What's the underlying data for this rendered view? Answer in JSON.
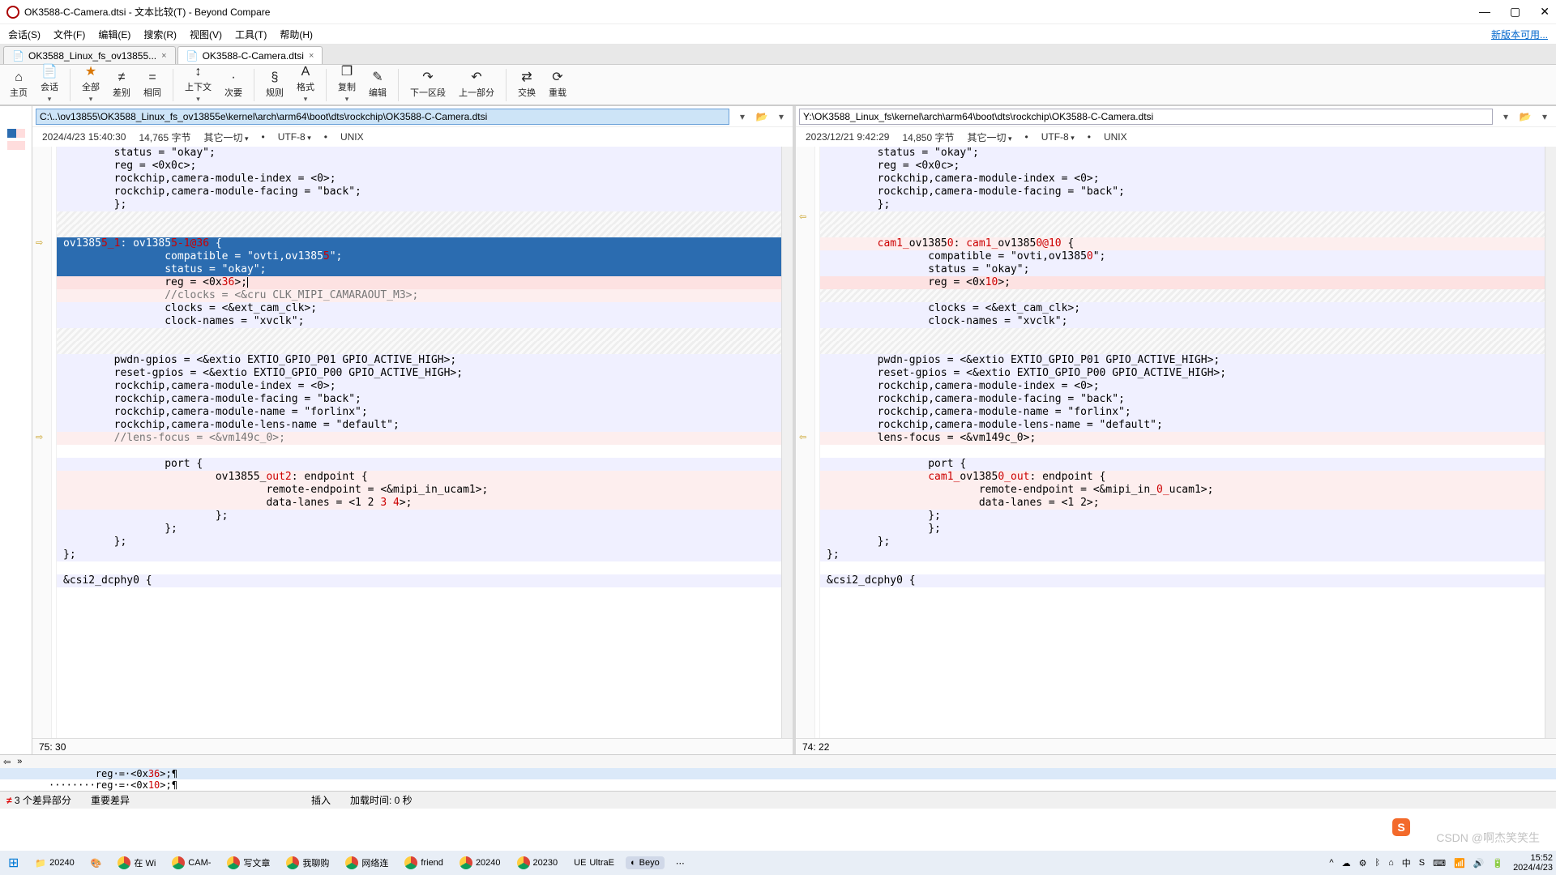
{
  "window": {
    "title": "OK3588-C-Camera.dtsi - 文本比较(T) - Beyond Compare",
    "new_version": "新版本可用..."
  },
  "menu": [
    "会话(S)",
    "文件(F)",
    "编辑(E)",
    "搜索(R)",
    "视图(V)",
    "工具(T)",
    "帮助(H)"
  ],
  "tabs": [
    {
      "label": "OK3588_Linux_fs_ov13855...",
      "active": false
    },
    {
      "label": "OK3588-C-Camera.dtsi",
      "active": true
    }
  ],
  "toolbar": [
    {
      "label": "主页",
      "glyph": "⌂"
    },
    {
      "label": "会话",
      "glyph": "📄",
      "drop": true
    },
    {
      "label": "全部",
      "glyph": "★",
      "drop": true,
      "hl": true
    },
    {
      "label": "差别",
      "glyph": "≠"
    },
    {
      "label": "相同",
      "glyph": "="
    },
    {
      "label": "上下文",
      "glyph": "↕",
      "drop": true
    },
    {
      "label": "次要",
      "glyph": "·"
    },
    {
      "label": "规则",
      "glyph": "§"
    },
    {
      "label": "格式",
      "glyph": "A",
      "drop": true
    },
    {
      "label": "复制",
      "glyph": "❐",
      "drop": true
    },
    {
      "label": "编辑",
      "glyph": "✎"
    },
    {
      "label": "下一区段",
      "glyph": "↷"
    },
    {
      "label": "上一部分",
      "glyph": "↶"
    },
    {
      "label": "交换",
      "glyph": "⇄"
    },
    {
      "label": "重载",
      "glyph": "⟳"
    }
  ],
  "left": {
    "path": "C:\\..\\ov13855\\OK3588_Linux_fs_ov13855e\\kernel\\arch\\arm64\\boot\\dts\\rockchip\\OK3588-C-Camera.dtsi",
    "meta": {
      "date": "2024/4/23 15:40:30",
      "size": "14,765 字节",
      "other": "其它一切",
      "enc": "UTF-8",
      "eol": "UNIX"
    },
    "pos": "75: 30",
    "lines": [
      {
        "cls": "l-ctx",
        "text": "        status = \"okay\";"
      },
      {
        "cls": "l-ctx",
        "text": "        reg = <0x0c>;"
      },
      {
        "cls": "l-ctx",
        "text": "        rockchip,camera-module-index = <0>;"
      },
      {
        "cls": "l-ctx",
        "text": "        rockchip,camera-module-facing = \"back\";"
      },
      {
        "cls": "l-ctx",
        "text": "        };"
      },
      {
        "cls": "l-hatch",
        "text": ""
      },
      {
        "cls": "l-hatch",
        "text": ""
      },
      {
        "cls": "l-sel",
        "text": "        ov13855_1: ov13855-1@36 {",
        "diff": [
          [
            "ov1385",
            "plain"
          ],
          [
            "5_1",
            true
          ],
          [
            ": ov1385",
            "plain"
          ],
          [
            "5-1@36",
            true
          ],
          [
            " {",
            "plain"
          ]
        ]
      },
      {
        "cls": "l-sel",
        "text": "                compatible = \"ovti,ov13855\";",
        "diff": [
          [
            "                compatible = \"ovti,ov1385",
            "plain"
          ],
          [
            "5",
            true
          ],
          [
            "\";",
            "plain"
          ]
        ]
      },
      {
        "cls": "l-sel",
        "text": "                status = \"okay\";"
      },
      {
        "cls": "l-pink",
        "text": "                reg = <0x36>;",
        "diff": [
          [
            "                reg = <0x",
            "plain"
          ],
          [
            "36",
            true
          ],
          [
            ">;",
            "plain"
          ]
        ],
        "caret": true
      },
      {
        "cls": "l-lpink",
        "text": "                //clocks = <&cru CLK_MIPI_CAMARAOUT_M3>;",
        "com": true
      },
      {
        "cls": "l-ctx",
        "text": "                clocks = <&ext_cam_clk>;"
      },
      {
        "cls": "l-ctx",
        "text": "                clock-names = \"xvclk\";"
      },
      {
        "cls": "l-hatch",
        "text": ""
      },
      {
        "cls": "l-hatch",
        "text": ""
      },
      {
        "cls": "l-ctx",
        "text": "        pwdn-gpios = <&extio EXTIO_GPIO_P01 GPIO_ACTIVE_HIGH>;"
      },
      {
        "cls": "l-ctx",
        "text": "        reset-gpios = <&extio EXTIO_GPIO_P00 GPIO_ACTIVE_HIGH>;"
      },
      {
        "cls": "l-ctx",
        "text": "        rockchip,camera-module-index = <0>;"
      },
      {
        "cls": "l-ctx",
        "text": "        rockchip,camera-module-facing = \"back\";"
      },
      {
        "cls": "l-ctx",
        "text": "        rockchip,camera-module-name = \"forlinx\";"
      },
      {
        "cls": "l-ctx",
        "text": "        rockchip,camera-module-lens-name = \"default\";"
      },
      {
        "cls": "l-lpink",
        "text": "        //lens-focus = <&vm149c_0>;",
        "com": true
      },
      {
        "cls": "l-plain",
        "text": ""
      },
      {
        "cls": "l-ctx",
        "text": "                port {"
      },
      {
        "cls": "l-lpink",
        "text": "                        ov13855_out2: endpoint {",
        "diff": [
          [
            "                        ov13855_",
            "plain"
          ],
          [
            "out2",
            true
          ],
          [
            ": endpoint {",
            "plain"
          ]
        ]
      },
      {
        "cls": "l-lpink",
        "text": "                                remote-endpoint = <&mipi_in_ucam1>;"
      },
      {
        "cls": "l-lpink",
        "text": "                                data-lanes = <1 2 3 4>;",
        "diff": [
          [
            "                                data-lanes = <1 2",
            "plain"
          ],
          [
            " 3 4",
            true
          ],
          [
            ">;",
            "plain"
          ]
        ]
      },
      {
        "cls": "l-ctx",
        "text": "                        };"
      },
      {
        "cls": "l-ctx",
        "text": "                };"
      },
      {
        "cls": "l-ctx",
        "text": "        };"
      },
      {
        "cls": "l-ctx",
        "text": "};"
      },
      {
        "cls": "l-plain",
        "text": ""
      },
      {
        "cls": "l-ctx",
        "text": "&csi2_dcphy0 {"
      }
    ]
  },
  "right": {
    "path": "Y:\\OK3588_Linux_fs\\kernel\\arch\\arm64\\boot\\dts\\rockchip\\OK3588-C-Camera.dtsi",
    "meta": {
      "date": "2023/12/21 9:42:29",
      "size": "14,850 字节",
      "other": "其它一切",
      "enc": "UTF-8",
      "eol": "UNIX"
    },
    "pos": "74: 22",
    "lines": [
      {
        "cls": "l-ctx",
        "text": "        status = \"okay\";"
      },
      {
        "cls": "l-ctx",
        "text": "        reg = <0x0c>;"
      },
      {
        "cls": "l-ctx",
        "text": "        rockchip,camera-module-index = <0>;"
      },
      {
        "cls": "l-ctx",
        "text": "        rockchip,camera-module-facing = \"back\";"
      },
      {
        "cls": "l-ctx",
        "text": "        };"
      },
      {
        "cls": "l-hatch",
        "text": ""
      },
      {
        "cls": "l-hatch",
        "text": ""
      },
      {
        "cls": "l-lpink",
        "text": "        cam1_ov13850: cam1_ov13850@10 {",
        "diff": [
          [
            "        ",
            "plain"
          ],
          [
            "cam1_",
            true
          ],
          [
            "ov1385",
            "plain"
          ],
          [
            "0",
            true
          ],
          [
            ": ",
            "plain"
          ],
          [
            "cam1_",
            true
          ],
          [
            "ov1385",
            "plain"
          ],
          [
            "0@10",
            true
          ],
          [
            " {",
            "plain"
          ]
        ]
      },
      {
        "cls": "l-ctx",
        "text": "                compatible = \"ovti,ov13850\";",
        "diff": [
          [
            "                compatible = \"ovti,ov1385",
            "plain"
          ],
          [
            "0",
            true
          ],
          [
            "\";",
            "plain"
          ]
        ]
      },
      {
        "cls": "l-ctx",
        "text": "                status = \"okay\";"
      },
      {
        "cls": "l-pink",
        "text": "                reg = <0x10>;",
        "diff": [
          [
            "                reg = <0x",
            "plain"
          ],
          [
            "10",
            true
          ],
          [
            ">;",
            "plain"
          ]
        ]
      },
      {
        "cls": "l-hatch",
        "text": ""
      },
      {
        "cls": "l-ctx",
        "text": "                clocks = <&ext_cam_clk>;"
      },
      {
        "cls": "l-ctx",
        "text": "                clock-names = \"xvclk\";"
      },
      {
        "cls": "l-hatch",
        "text": ""
      },
      {
        "cls": "l-hatch",
        "text": ""
      },
      {
        "cls": "l-ctx",
        "text": "        pwdn-gpios = <&extio EXTIO_GPIO_P01 GPIO_ACTIVE_HIGH>;"
      },
      {
        "cls": "l-ctx",
        "text": "        reset-gpios = <&extio EXTIO_GPIO_P00 GPIO_ACTIVE_HIGH>;"
      },
      {
        "cls": "l-ctx",
        "text": "        rockchip,camera-module-index = <0>;"
      },
      {
        "cls": "l-ctx",
        "text": "        rockchip,camera-module-facing = \"back\";"
      },
      {
        "cls": "l-ctx",
        "text": "        rockchip,camera-module-name = \"forlinx\";"
      },
      {
        "cls": "l-ctx",
        "text": "        rockchip,camera-module-lens-name = \"default\";"
      },
      {
        "cls": "l-lpink",
        "text": "        lens-focus = <&vm149c_0>;"
      },
      {
        "cls": "l-plain",
        "text": ""
      },
      {
        "cls": "l-ctx",
        "text": "                port {"
      },
      {
        "cls": "l-lpink",
        "text": "                cam1_ov13850_out: endpoint {",
        "diff": [
          [
            "                ",
            "plain"
          ],
          [
            "cam1_",
            true
          ],
          [
            "ov1385",
            "plain"
          ],
          [
            "0_out",
            true
          ],
          [
            ": endpoint {",
            "plain"
          ]
        ]
      },
      {
        "cls": "l-lpink",
        "text": "                        remote-endpoint = <&mipi_in_0_ucam1>;",
        "diff": [
          [
            "                        remote-endpoint = <&mipi_in_",
            "plain"
          ],
          [
            "0_",
            true
          ],
          [
            "ucam1>;",
            "plain"
          ]
        ]
      },
      {
        "cls": "l-lpink",
        "text": "                        data-lanes = <1 2>;"
      },
      {
        "cls": "l-ctx",
        "text": "                };"
      },
      {
        "cls": "l-ctx",
        "text": "                };"
      },
      {
        "cls": "l-ctx",
        "text": "        };"
      },
      {
        "cls": "l-ctx",
        "text": "};"
      },
      {
        "cls": "l-plain",
        "text": ""
      },
      {
        "cls": "l-ctx",
        "text": "&csi2_dcphy0 {"
      }
    ]
  },
  "merge": {
    "line1": {
      "text": "        reg·=·<0x36>;¶",
      "hl": "36"
    },
    "line2": {
      "text": "········reg·=·<0x10>;¶",
      "hl": "10"
    }
  },
  "status": {
    "diff": "3 个差异部分",
    "important": "重要差异",
    "mode": "插入",
    "load": "加载时间: 0 秒"
  },
  "taskbar": {
    "items": [
      {
        "label": "",
        "glyph": "⊞",
        "win": true
      },
      {
        "label": "20240",
        "glyph": "📁"
      },
      {
        "label": "",
        "glyph": "🎨"
      },
      {
        "label": "在 Wi",
        "chrome": true
      },
      {
        "label": "CAM-",
        "chrome": true
      },
      {
        "label": "写文章",
        "chrome": true
      },
      {
        "label": "我聊购",
        "chrome": true
      },
      {
        "label": "网络连",
        "chrome": true
      },
      {
        "label": "friend",
        "chrome": true
      },
      {
        "label": "20240",
        "chrome": true
      },
      {
        "label": "20230",
        "chrome": true
      },
      {
        "label": "UltraE",
        "glyph": "UE"
      },
      {
        "label": "Beyo",
        "glyph": "◐",
        "active": true
      },
      {
        "label": "",
        "glyph": "⋯"
      }
    ],
    "tray": [
      "^",
      "☁",
      "⚙",
      "ᛒ",
      "⌂",
      "中",
      "S",
      "⌨",
      "📶",
      "🔊",
      "🔋"
    ],
    "time": "15:52",
    "date": "2024/4/23"
  },
  "watermark": "CSDN @啊杰笑笑生"
}
